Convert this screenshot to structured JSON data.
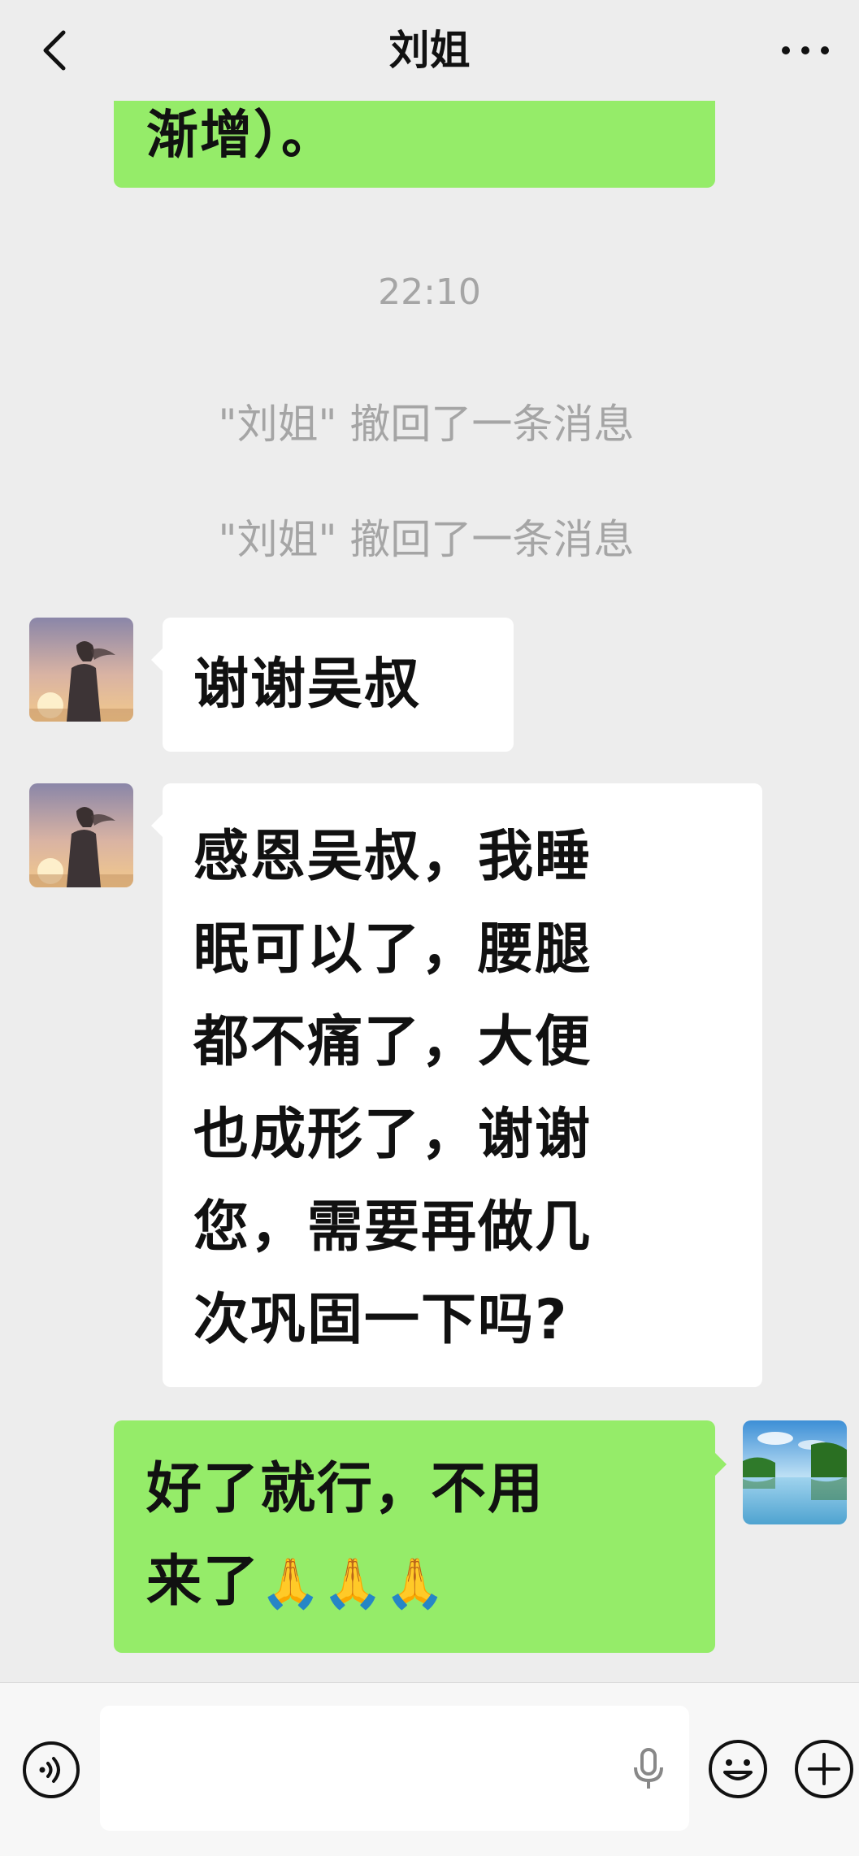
{
  "header": {
    "title": "刘姐",
    "back_icon": "chevron-left-icon",
    "more_icon": "more-dots-icon"
  },
  "messages": {
    "prev_partial_text": "渐增）。",
    "timestamp": "22:10",
    "recall_1": "\"刘姐\" 撤回了一条消息",
    "recall_2": "\"刘姐\" 撤回了一条消息",
    "in_1_text": "谢谢吴叔",
    "in_2_lines": [
      "感恩吴叔，我睡",
      "眠可以了，腰腿",
      "都不痛了，大便",
      "也成形了，谢谢",
      "您，需要再做几",
      "次巩固一下吗?"
    ],
    "out_1_line1": "好了就行，不用",
    "out_1_line2": "来了",
    "out_1_emoji": "🙏🙏🙏"
  },
  "input_bar": {
    "input_value": "",
    "voice_icon": "voice-toggle-icon",
    "mic_icon": "microphone-icon",
    "emoji_icon": "emoji-icon",
    "plus_icon": "plus-icon"
  },
  "colors": {
    "background": "#ededed",
    "outgoing_bubble": "#95ec69",
    "incoming_bubble": "#ffffff",
    "system_text": "#a5a5a5"
  }
}
